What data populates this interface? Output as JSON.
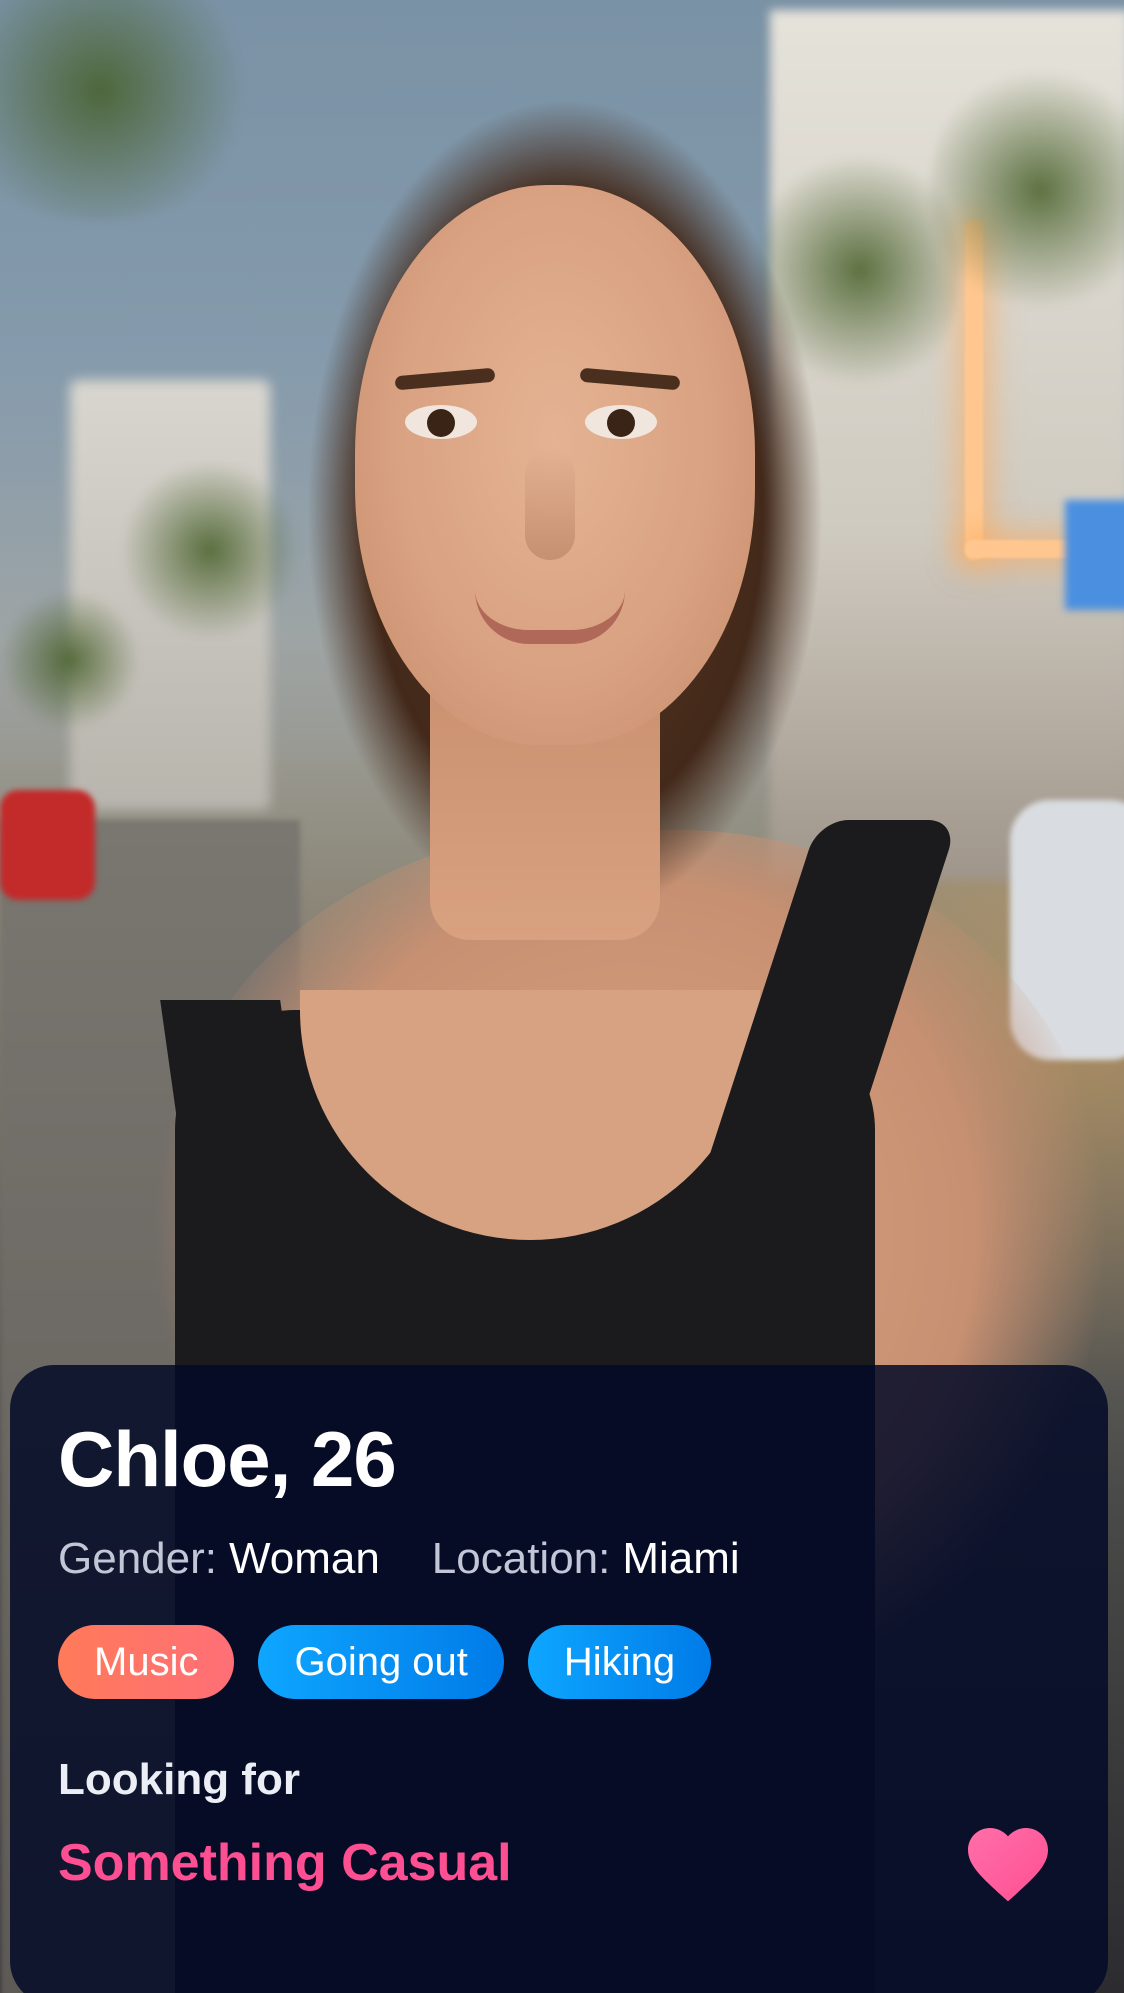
{
  "profile": {
    "name_age": "Chloe, 26",
    "gender_label": "Gender:",
    "gender_value": "Woman",
    "location_label": "Location:",
    "location_value": "Miami",
    "interests": [
      "Music",
      "Going out",
      "Hiking"
    ],
    "looking_for_label": "Looking for",
    "looking_for_value": "Something Casual"
  },
  "icons": {
    "like": "heart-icon"
  },
  "colors": {
    "accent_pink": "#ff4f93",
    "tag_music": "#ff7561",
    "tag_blue": "#0a94f5",
    "panel_bg": "#040a28"
  }
}
